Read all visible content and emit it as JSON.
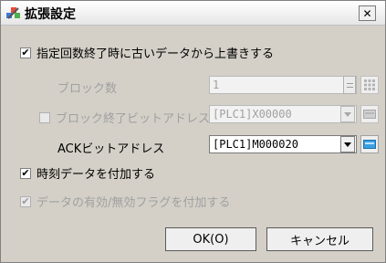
{
  "window": {
    "title": "拡張設定",
    "close_glyph": "✕"
  },
  "option_overwrite": {
    "label": "指定回数終了時に古いデータから上書きする",
    "checked": true
  },
  "block_count": {
    "label": "ブロック数",
    "value": "1"
  },
  "block_end_bit": {
    "label": "ブロック終了ビットアドレス",
    "value": "[PLC1]X00000",
    "checked": false
  },
  "ack_bit": {
    "label": "ACKビットアドレス",
    "value": "[PLC1]M000020"
  },
  "option_time": {
    "label": "時刻データを付加する",
    "checked": true
  },
  "option_valid_flag": {
    "label": "データの有効/無効フラグを付加する",
    "checked": true
  },
  "buttons": {
    "ok": "OK(O)",
    "cancel": "キャンセル"
  },
  "check_glyph": "✔",
  "colors": {
    "window_bg": "#d4d0c8",
    "disabled_text": "#a0a0a0",
    "icon_blue": "#3aa0e0"
  }
}
